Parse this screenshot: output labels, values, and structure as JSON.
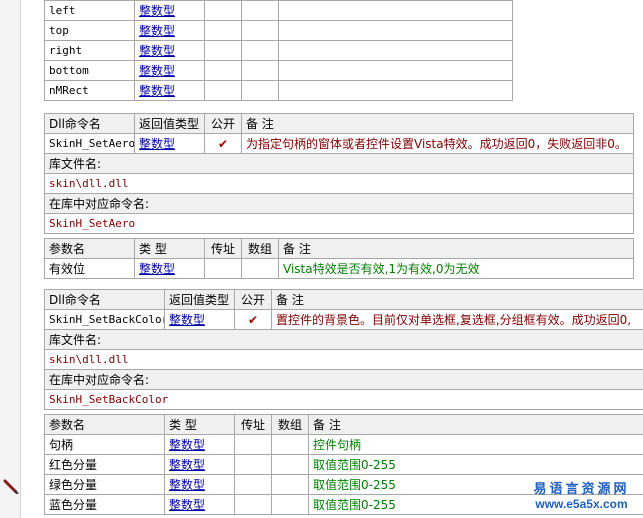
{
  "top_rows": [
    {
      "name": "left",
      "type": "整数型"
    },
    {
      "name": "top",
      "type": "整数型"
    },
    {
      "name": "right",
      "type": "整数型"
    },
    {
      "name": "bottom",
      "type": "整数型"
    },
    {
      "name": "nMRect",
      "type": "整数型"
    }
  ],
  "labels": {
    "dll_cmd": "Dll命令名",
    "ret_type": "返回值类型",
    "public": "公开",
    "remark": "备 注",
    "lib_file": "库文件名:",
    "lib_cmd": "在库中对应命令名:",
    "param_name": "参数名",
    "type": "类 型",
    "byref": "传址",
    "array": "数组",
    "check": "✔"
  },
  "cmd1": {
    "name": "SkinH_SetAero",
    "ret": "整数型",
    "remark": "为指定句柄的窗体或者控件设置Vista特效。成功返回0，失败返回非0。",
    "lib": "skin\\dll.dll",
    "lib_name": "SkinH_SetAero",
    "params": [
      {
        "name": "有效位",
        "type": "整数型",
        "remark": "Vista特效是否有效,1为有效,0为无效"
      }
    ]
  },
  "cmd2": {
    "name": "SkinH_SetBackColor",
    "ret": "整数型",
    "remark": "置控件的背景色。目前仅对单选框,复选框,分组框有效。成功返回0,",
    "lib": "skin\\dll.dll",
    "lib_name": "SkinH_SetBackColor",
    "params": [
      {
        "name": "句柄",
        "type": "整数型",
        "remark": "控件句柄"
      },
      {
        "name": "红色分量",
        "type": "整数型",
        "remark": "取值范围0-255"
      },
      {
        "name": "绿色分量",
        "type": "整数型",
        "remark": "取值范围0-255"
      },
      {
        "name": "蓝色分量",
        "type": "整数型",
        "remark": "取值范围0-255"
      }
    ]
  },
  "watermark": {
    "line1": "易语言资源网",
    "line2": "www.e5a5x.com"
  },
  "icons": {
    "pen": "pen-icon",
    "check": "checkmark-icon"
  },
  "colors": {
    "link": "#0000a8",
    "maroon": "#800000",
    "green": "#008000",
    "header_bg": "#f0f0f0"
  }
}
